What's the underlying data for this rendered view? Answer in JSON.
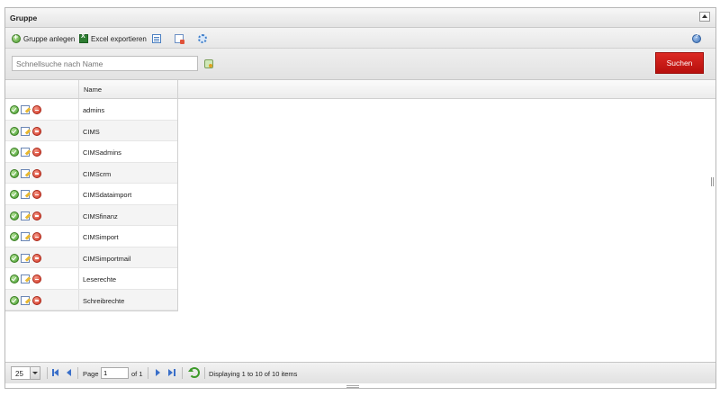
{
  "panel": {
    "title": "Gruppe"
  },
  "toolbar": {
    "add_group_label": "Gruppe anlegen",
    "excel_export_label": "Excel exportieren",
    "icons": [
      "add-icon",
      "excel-icon",
      "document-icon",
      "document-delete-icon",
      "gear-icon",
      "help-icon"
    ]
  },
  "search": {
    "placeholder": "Schnellsuche nach Name",
    "button_label": "Suchen",
    "button_color": "#c91a16"
  },
  "grid": {
    "columns": [
      "",
      "Name"
    ],
    "rows": [
      {
        "name": "admins"
      },
      {
        "name": "CIMS"
      },
      {
        "name": "CIMSadmins"
      },
      {
        "name": "CIMScrm"
      },
      {
        "name": "CIMSdataimport"
      },
      {
        "name": "CIMSfinanz"
      },
      {
        "name": "CIMSimport"
      },
      {
        "name": "CIMSimportmail"
      },
      {
        "name": "Leserechte"
      },
      {
        "name": "Schreibrechte"
      }
    ]
  },
  "pager": {
    "page_size": "25",
    "page_label": "Page",
    "current_page": "1",
    "of_label": "of 1",
    "status": "Displaying 1 to 10 of 10 items"
  }
}
